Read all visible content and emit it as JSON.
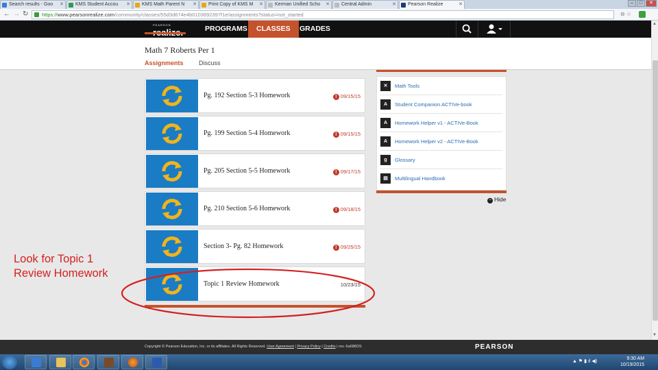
{
  "browser": {
    "tabs": [
      {
        "title": "Search results - Goo",
        "color": "#3b7ad8"
      },
      {
        "title": "KMS Student Accou",
        "color": "#2e9e4e"
      },
      {
        "title": "KMS Math Parent N",
        "color": "#e6a817"
      },
      {
        "title": "Print Copy of KMS M",
        "color": "#e6a817"
      },
      {
        "title": "Kerman Unified Scho",
        "color": "#bbbbbb"
      },
      {
        "title": "Central Admin",
        "color": "#bbbbbb"
      },
      {
        "title": "Pearson Realize",
        "color": "#1d3d6e",
        "active": true
      }
    ],
    "url_scheme": "https://",
    "url_host": "www.pearsonrealize.com",
    "url_path": "/community/classes/55d3d674e4b0103692397f1e/assignments?status=not_started"
  },
  "nav": {
    "brand_small": "PEARSON",
    "brand": "realize.",
    "items": [
      "PROGRAMS",
      "CLASSES",
      "GRADES"
    ],
    "active": "CLASSES"
  },
  "class": {
    "title": "Math 7 Roberts Per 1",
    "tabs": [
      "Assignments",
      "Discuss"
    ]
  },
  "assignments": [
    {
      "title": "Pg. 192 Section 5-3 Homework",
      "date": "09/15/15",
      "overdue": true
    },
    {
      "title": "Pg. 199 Section 5-4 Homework",
      "date": "09/15/15",
      "overdue": true
    },
    {
      "title": "Pg. 205 Section 5-5 Homework",
      "date": "09/17/15",
      "overdue": true
    },
    {
      "title": "Pg. 210 Section 5-6 Homework",
      "date": "09/18/15",
      "overdue": true
    },
    {
      "title": "Section 3- Pg. 82 Homework",
      "date": "09/25/15",
      "overdue": true
    },
    {
      "title": "Topic 1 Review Homework",
      "date": "10/23/15",
      "overdue": false
    }
  ],
  "tools": [
    {
      "label": "Math Tools",
      "icon": "math-tools-icon",
      "glyph": "✕"
    },
    {
      "label": "Student Companion ACTIVe-book",
      "icon": "ebook-icon",
      "glyph": "A"
    },
    {
      "label": "Homework Helper v1 - ACTIVe-Book",
      "icon": "ebook-icon",
      "glyph": "A"
    },
    {
      "label": "Homework Helper v2 - ACTIVe-Book",
      "icon": "ebook-icon",
      "glyph": "A"
    },
    {
      "label": "Glossary",
      "icon": "glossary-icon",
      "glyph": "g"
    },
    {
      "label": "Multilingual Handbook",
      "icon": "handbook-icon",
      "glyph": "▤"
    }
  ],
  "hide_label": "Hide",
  "annotation": {
    "line1": "Look for Topic 1",
    "line2": "Review Homework",
    "color": "#d42020"
  },
  "footer": {
    "copyright": "Copyright © Pearson Education, Inc. or its affiliates. All Rights Reserved.",
    "user_agreement": "User Agreement",
    "privacy": "Privacy Policy",
    "credits": "Credits",
    "rev": "rev. 6a688OS",
    "logo": "PEARSON"
  },
  "taskbar": {
    "time": "9:30 AM",
    "date": "10/19/2015"
  },
  "colors": {
    "accent": "#c4522c",
    "overdue": "#c0392b",
    "link": "#2b6cb0",
    "thumb_bg": "#1a7cc4",
    "thumb_arrows": "#f2b31c"
  }
}
